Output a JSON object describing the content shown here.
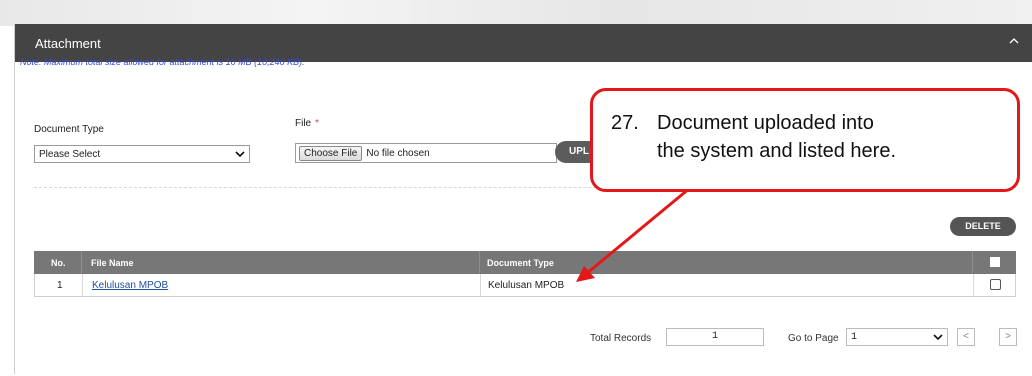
{
  "panel": {
    "title": "Attachment",
    "note": "Note: Maximum total size allowed for attachment is 10 MB (10,240 KB)."
  },
  "form": {
    "document_type_label": "Document Type",
    "document_type_value": "Please Select",
    "file_label": "File",
    "required_mark": "*",
    "choose_file_label": "Choose File",
    "no_file_text": "No file chosen",
    "upload_label": "UPL"
  },
  "actions": {
    "delete_label": "DELETE"
  },
  "table": {
    "headers": {
      "no": "No.",
      "file_name": "File Name",
      "document_type": "Document Type"
    },
    "rows": [
      {
        "no": "1",
        "file_name": "Kelulusan MPOB",
        "document_type": "Kelulusan MPOB",
        "checked": false
      }
    ]
  },
  "footer": {
    "total_records_label": "Total Records",
    "total_records_value": "1",
    "go_to_page_label": "Go to Page",
    "page_value": "1",
    "prev_symbol": "<",
    "next_symbol": ">"
  },
  "callout": {
    "number": "27.",
    "line1": "Document uploaded into",
    "line2": "the system and listed here."
  },
  "colors": {
    "header_bg": "#444444",
    "table_head_bg": "#777777",
    "callout_border": "#e41818",
    "note_text": "#3a4bc8",
    "link": "#1f4e9e"
  }
}
